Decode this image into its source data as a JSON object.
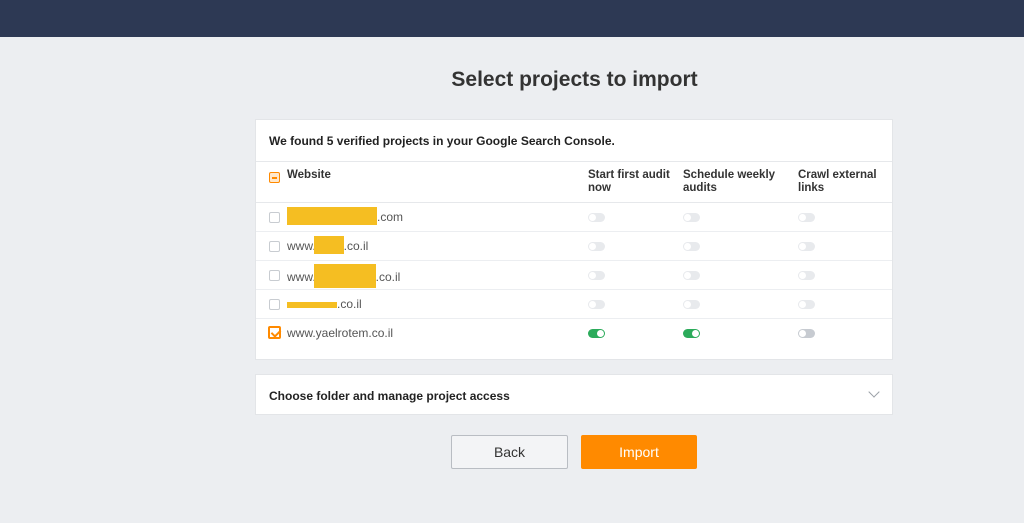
{
  "page": {
    "title": "Select projects to import"
  },
  "projects_card": {
    "found_text": "We found 5 verified projects in your Google Search Console.",
    "columns": {
      "website": "Website",
      "start_audit": "Start first audit now",
      "schedule_weekly": "Schedule weekly audits",
      "crawl_external": "Crawl external links"
    },
    "rows": [
      {
        "prefix": "",
        "suffix": ".com",
        "checked": false,
        "start_audit": false,
        "schedule_weekly": false,
        "crawl_external": false
      },
      {
        "prefix": "www.",
        "suffix": ".co.il",
        "checked": false,
        "start_audit": false,
        "schedule_weekly": false,
        "crawl_external": false
      },
      {
        "prefix": "www.",
        "suffix": ".co.il",
        "checked": false,
        "start_audit": false,
        "schedule_weekly": false,
        "crawl_external": false
      },
      {
        "prefix": "",
        "suffix": ".co.il",
        "checked": false,
        "start_audit": false,
        "schedule_weekly": false,
        "crawl_external": false
      },
      {
        "prefix": "www.yaelrotem.co.il",
        "suffix": "",
        "checked": true,
        "start_audit": true,
        "schedule_weekly": true,
        "crawl_external": false
      }
    ]
  },
  "folder_section": {
    "title": "Choose folder and manage project access"
  },
  "buttons": {
    "back": "Back",
    "import": "Import"
  },
  "colors": {
    "accent": "#ff8a00",
    "toggle_on": "#2cab5b",
    "header_bar": "#2d3954"
  }
}
